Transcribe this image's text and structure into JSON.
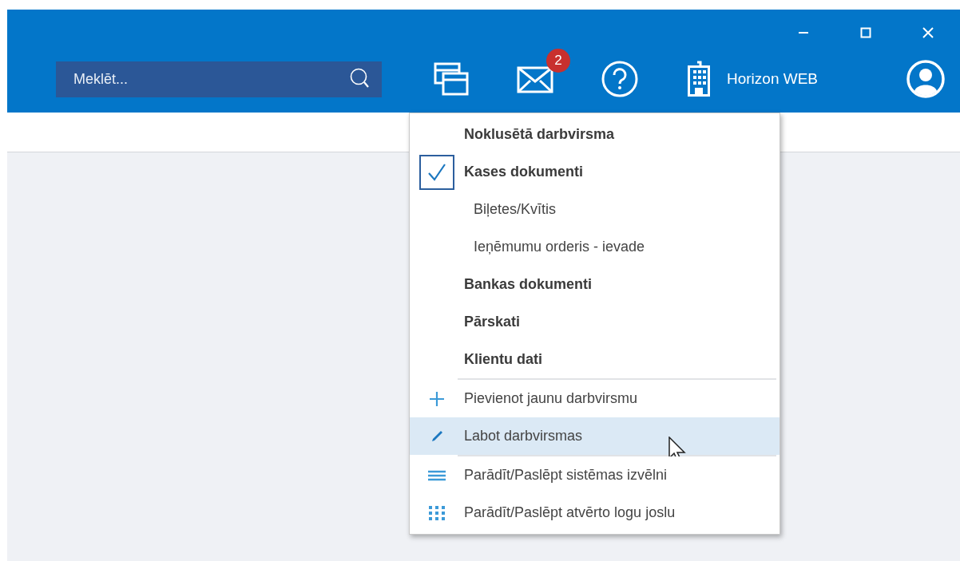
{
  "toolbar": {
    "search": {
      "placeholder": "Meklēt..."
    },
    "mail_badge": "2",
    "company": "Horizon WEB"
  },
  "desktop_menu": {
    "items": [
      {
        "kind": "heading",
        "label": "Noklusētā darbvirsma",
        "checked": false,
        "hovered": false
      },
      {
        "kind": "heading",
        "label": "Kases dokumenti",
        "checked": true,
        "hovered": false
      },
      {
        "kind": "subitem",
        "label": "Biļetes/Kvītis",
        "hovered": false
      },
      {
        "kind": "subitem",
        "label": "Ieņēmumu orderis - ievade",
        "hovered": false
      },
      {
        "kind": "heading",
        "label": "Bankas dokumenti",
        "checked": false,
        "hovered": false
      },
      {
        "kind": "heading",
        "label": "Pārskati",
        "checked": false,
        "hovered": false
      },
      {
        "kind": "heading",
        "label": "Klientu dati",
        "checked": false,
        "hovered": false
      },
      {
        "kind": "separator"
      },
      {
        "kind": "action",
        "label": "Pievienot jaunu darbvirsmu",
        "hovered": false
      },
      {
        "kind": "action",
        "label": "Labot darbvirsmas",
        "hovered": true
      },
      {
        "kind": "separator"
      },
      {
        "kind": "action",
        "label": "Parādīt/Paslēpt sistēmas izvēlni",
        "hovered": false
      },
      {
        "kind": "action",
        "label": "Parādīt/Paslēpt atvērto logu joslu",
        "hovered": false
      }
    ]
  }
}
